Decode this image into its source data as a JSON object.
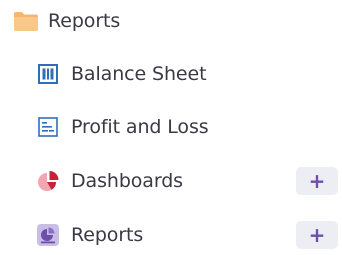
{
  "folder": {
    "label": "Reports",
    "icon": "folder-icon",
    "icon_color": "#f5b76e"
  },
  "items": [
    {
      "label": "Balance Sheet",
      "icon": "balance-sheet-icon",
      "icon_color": "#2f6fb5"
    },
    {
      "label": "Profit and Loss",
      "icon": "profit-and-loss-icon",
      "icon_color": "#2f6fb5"
    },
    {
      "label": "Dashboards",
      "icon": "pie-chart-icon",
      "icon_color": "#c8213a",
      "action_label": "+"
    },
    {
      "label": "Reports",
      "icon": "report-pie-icon",
      "icon_color": "#6b4fa8",
      "action_label": "+"
    }
  ],
  "colors": {
    "text": "#3a3a44",
    "add_button_bg": "#edeef3",
    "add_button_fg": "#6b4fa8"
  }
}
